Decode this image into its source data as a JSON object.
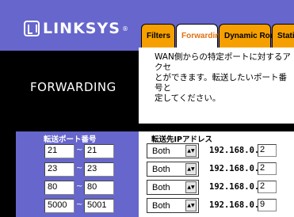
{
  "brand": {
    "name": "LINKSYS",
    "reg": "®"
  },
  "tabs": [
    {
      "label": "Filters"
    },
    {
      "label": "Forwarding"
    },
    {
      "label": "Dynamic Routing"
    },
    {
      "label": "Static"
    }
  ],
  "page_title": "FORWARDING",
  "description": "WAN側からの特定ポートに対するアクセ\nとができます。転送したいポート番号と\n定してください。",
  "port_header": "転送ポート番号",
  "dest_header": "転送先IPアドレス",
  "range_separator": "~",
  "ip_prefix": "192.168.0.",
  "rows": [
    {
      "start": "21",
      "end": "21",
      "protocol": "Both",
      "ip": "2"
    },
    {
      "start": "23",
      "end": "23",
      "protocol": "Both",
      "ip": "2"
    },
    {
      "start": "80",
      "end": "80",
      "protocol": "Both",
      "ip": "2"
    },
    {
      "start": "5000",
      "end": "5001",
      "protocol": "Both",
      "ip": "9"
    }
  ],
  "colors": {
    "header": "#6666cc",
    "tab": "#f5a000",
    "active_tab_text": "#e07010"
  }
}
